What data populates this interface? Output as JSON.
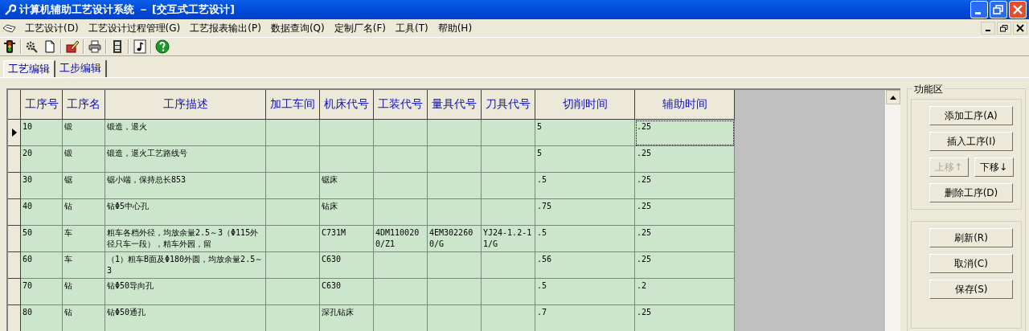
{
  "window": {
    "title": "计算机辅助工艺设计系统 － [交互式工艺设计]"
  },
  "menu": [
    {
      "label": "工艺设计(D)"
    },
    {
      "label": "工艺设计过程管理(G)"
    },
    {
      "label": "工艺报表输出(P)"
    },
    {
      "label": "数据查询(Q)"
    },
    {
      "label": "定制厂名(F)"
    },
    {
      "label": "工具(T)"
    },
    {
      "label": "帮助(H)"
    }
  ],
  "toolbar": [
    {
      "kind": "traffic"
    },
    {
      "kind": "tools"
    },
    {
      "kind": "page"
    },
    {
      "kind": "pencil"
    },
    {
      "kind": "printer"
    },
    {
      "kind": "film"
    },
    {
      "kind": "note"
    },
    {
      "kind": "help"
    }
  ],
  "tabs": [
    {
      "label": "工艺编辑",
      "selected": true
    },
    {
      "label": "工步编辑",
      "selected": false
    }
  ],
  "table": {
    "columns": [
      "工序号",
      "工序名",
      "工序描述",
      "加工车间",
      "机床代号",
      "工装代号",
      "量具代号",
      "刀具代号",
      "切削时间",
      "辅助时间"
    ],
    "rows": [
      {
        "selected": true,
        "cells": [
          "10",
          "锻",
          "锻造，退火",
          "",
          "",
          "",
          "",
          "",
          "5",
          ".25"
        ]
      },
      {
        "selected": false,
        "cells": [
          "20",
          "锻",
          "锻造，退火工艺路线号",
          "",
          "",
          "",
          "",
          "",
          "5",
          ".25"
        ]
      },
      {
        "selected": false,
        "cells": [
          "30",
          "锯",
          "锯小端，保持总长853",
          "",
          "锯床",
          "",
          "",
          "",
          ".5",
          ".25"
        ]
      },
      {
        "selected": false,
        "cells": [
          "40",
          "钻",
          "钻Φ5中心孔",
          "",
          "钻床",
          "",
          "",
          "",
          ".75",
          ".25"
        ]
      },
      {
        "selected": false,
        "cells": [
          "50",
          "车",
          "粗车各档外径，均放余量2.5～3（Φ115外径只车一段），精车外园，留",
          "",
          "C731M",
          "4DM1100200/Z1",
          "4EM3022600/G",
          "YJ24-1.2-11/G",
          ".5",
          ".25"
        ]
      },
      {
        "selected": false,
        "cells": [
          "60",
          "车",
          "（1）粗车B面及Φ180外圆，均放余量2.5～3",
          "",
          "C630",
          "",
          "",
          "",
          ".56",
          ".25"
        ]
      },
      {
        "selected": false,
        "cells": [
          "70",
          "钻",
          "钻Φ50导向孔",
          "",
          "C630",
          "",
          "",
          "",
          ".5",
          ".2"
        ]
      },
      {
        "selected": false,
        "cells": [
          "80",
          "钻",
          "钻Φ50通孔",
          "",
          "深孔钻床",
          "",
          "",
          "",
          ".7",
          ".25"
        ]
      }
    ]
  },
  "panel": {
    "title": "功能区",
    "groups": [
      [
        {
          "label": "添加工序(A)",
          "disabled": false
        },
        {
          "label": "插入工序(I)",
          "disabled": false
        },
        {
          "label": "上移↑",
          "disabled": true
        },
        {
          "label": "下移↓",
          "disabled": false
        },
        {
          "label": "删除工序(D)",
          "disabled": false
        }
      ],
      [
        {
          "label": "刷新(R)",
          "disabled": false
        },
        {
          "label": "取消(C)",
          "disabled": false
        },
        {
          "label": "保存(S)",
          "disabled": false
        }
      ]
    ]
  }
}
